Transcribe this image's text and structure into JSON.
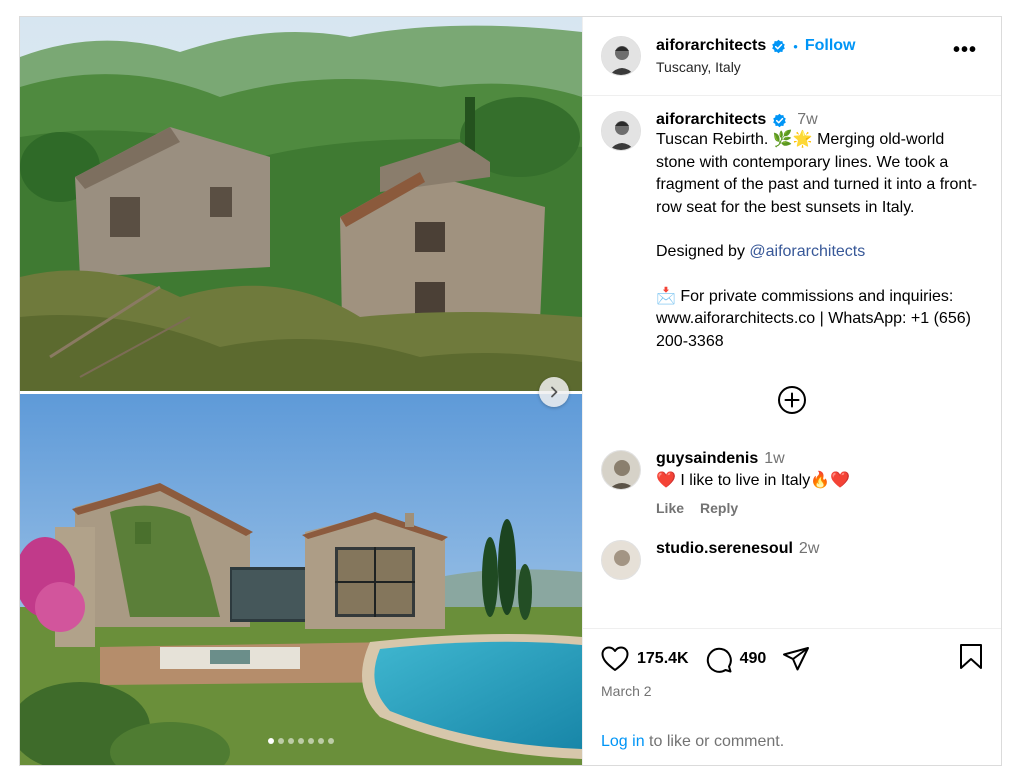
{
  "header": {
    "username": "aiforarchitects",
    "separator": "•",
    "follow_label": "Follow",
    "location": "Tuscany, Italy",
    "more_label": "•••",
    "icons": [
      "verified-badge-icon",
      "more-options-icon"
    ]
  },
  "media": {
    "carousel_dots": 7,
    "active_dot": 0,
    "next_icon": "chevron-right-icon"
  },
  "caption": {
    "username": "aiforarchitects",
    "time": "7w",
    "line1": "Tuscan Rebirth. 🌿🌟 Merging old-world stone with contemporary lines. We took a fragment of the past and turned it into a front-row seat for the best sunsets in Italy.",
    "designed_by_prefix": "Designed by ",
    "designed_by_mention": "@aiforarchitects",
    "contact": "📩 For private commissions and inquiries: www.aiforarchitects.co | WhatsApp: +1 (656) 200-3368",
    "load_more_icon": "plus-circle-icon"
  },
  "comments": [
    {
      "username": "guysaindenis",
      "time": "1w",
      "text": "❤️ I like to live in Italy🔥❤️",
      "like_label": "Like",
      "reply_label": "Reply"
    },
    {
      "username": "studio.serenesoul",
      "time": "2w"
    }
  ],
  "actions": {
    "likes": "175.4K",
    "comments": "490",
    "date": "March 2",
    "icons": [
      "heart-icon",
      "comment-icon",
      "share-icon",
      "bookmark-icon"
    ]
  },
  "login": {
    "link": "Log in",
    "rest": " to like or comment."
  },
  "colors": {
    "link_blue": "#0095f6",
    "verified_blue": "#0095f6",
    "muted": "#737373",
    "mention": "#385898"
  }
}
